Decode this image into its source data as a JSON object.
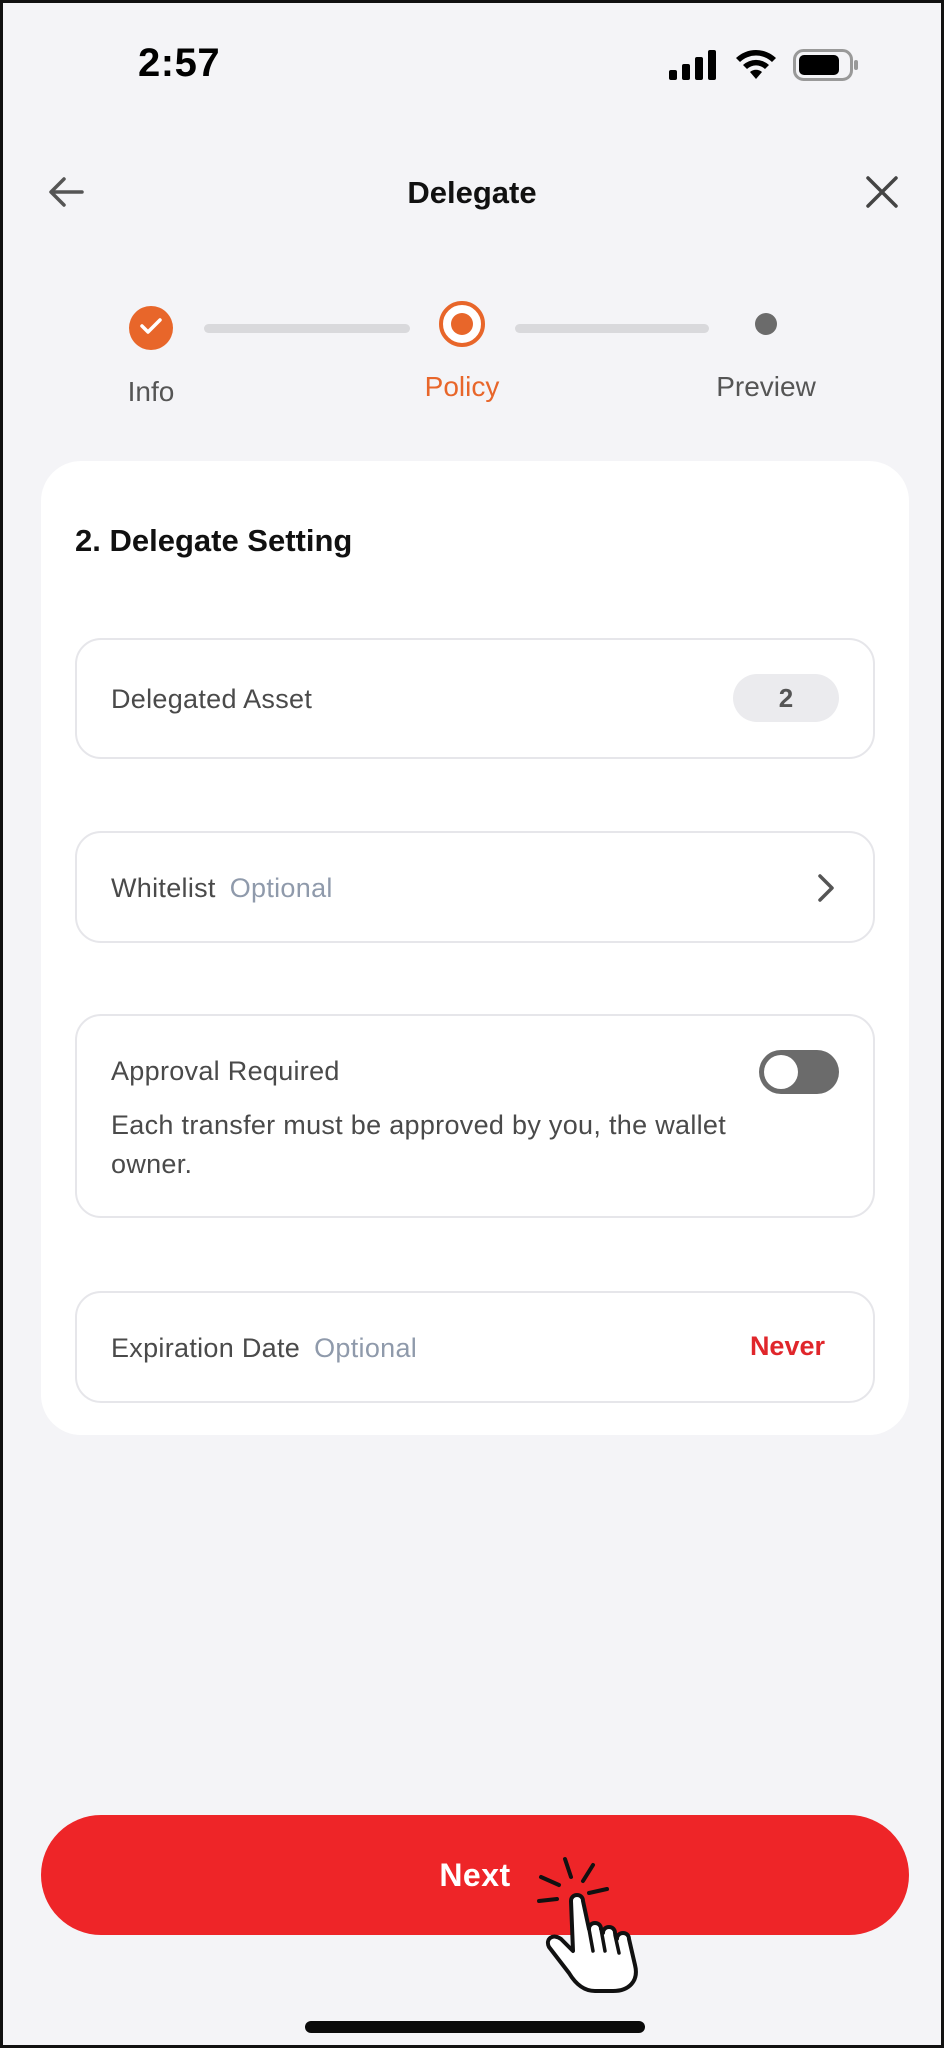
{
  "status_bar": {
    "time": "2:57",
    "icons": [
      "cellular-signal-icon",
      "wifi-icon",
      "battery-icon"
    ]
  },
  "header": {
    "title": "Delegate",
    "back_icon": "arrow-left-icon",
    "close_icon": "close-icon"
  },
  "stepper": {
    "steps": [
      {
        "label": "Info",
        "state": "completed"
      },
      {
        "label": "Policy",
        "state": "active"
      },
      {
        "label": "Preview",
        "state": "pending"
      }
    ],
    "colors": {
      "active": "#e8662a",
      "pending": "#6b6b6b",
      "track": "#d9d9dc"
    }
  },
  "card": {
    "title": "2. Delegate Setting",
    "delegated_asset": {
      "label": "Delegated Asset",
      "count": "2"
    },
    "whitelist": {
      "label": "Whitelist",
      "optional": "Optional",
      "icon": "chevron-right-icon"
    },
    "approval": {
      "label": "Approval Required",
      "description": "Each transfer must be approved by you, the wallet owner.",
      "enabled": false
    },
    "expiration": {
      "label": "Expiration Date",
      "optional": "Optional",
      "value": "Never"
    }
  },
  "footer": {
    "next_label": "Next",
    "accent": "#ee2528"
  }
}
